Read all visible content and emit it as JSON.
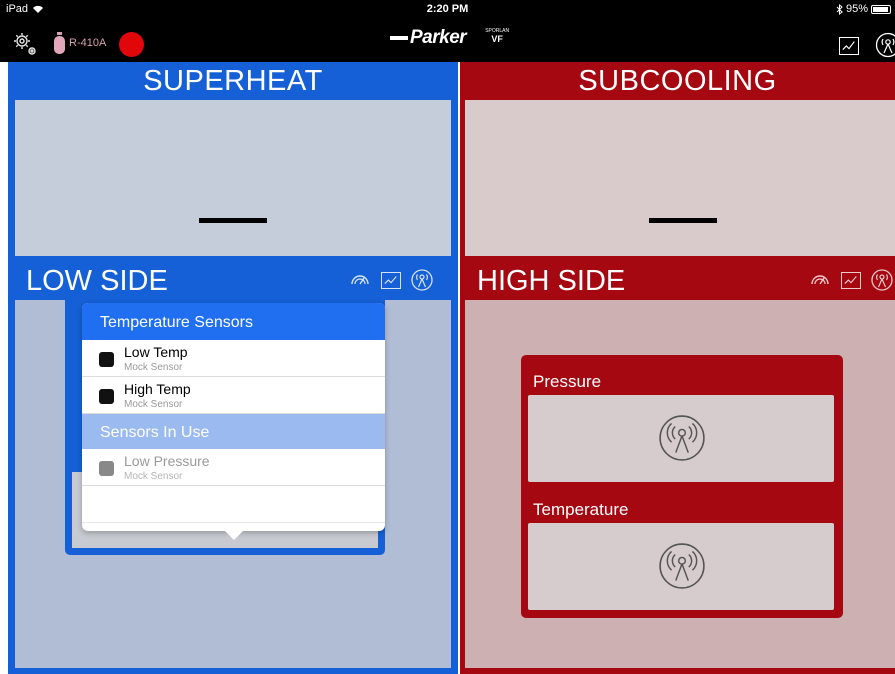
{
  "status": {
    "device": "iPad",
    "time": "2:20 PM",
    "battery": "95%",
    "battery_level": 0.95
  },
  "nav": {
    "refrigerant": "R-410A",
    "brand": "Parker",
    "sub_brand": "SPORLAN",
    "sub_brand_mark": "VF",
    "recording_color": "#e0060a"
  },
  "superheat": {
    "title": "SUPERHEAT",
    "value": "—"
  },
  "subcooling": {
    "title": "SUBCOOLING",
    "value": "—"
  },
  "low_side": {
    "title": "LOW SIDE"
  },
  "high_side": {
    "title": "HIGH SIDE",
    "pressure_label": "Pressure",
    "temperature_label": "Temperature"
  },
  "popover": {
    "header": "Temperature Sensors",
    "items": [
      {
        "name": "Low Temp",
        "sub": "Mock Sensor"
      },
      {
        "name": "High Temp",
        "sub": "Mock Sensor"
      }
    ],
    "section": "Sensors In Use",
    "in_use": [
      {
        "name": "Low Pressure",
        "sub": "Mock Sensor"
      }
    ]
  },
  "colors": {
    "low_side": "#1560d6",
    "high_side": "#a50811",
    "popover_header": "#1f6ff0",
    "popover_section": "#9abaf0"
  },
  "icons": [
    "settings-gear-icon",
    "refrigerant-tank-icon",
    "graph-icon",
    "antenna-icon",
    "gauge-icon",
    "flask-icon",
    "wifi-icon",
    "bluetooth-icon",
    "battery-icon"
  ]
}
